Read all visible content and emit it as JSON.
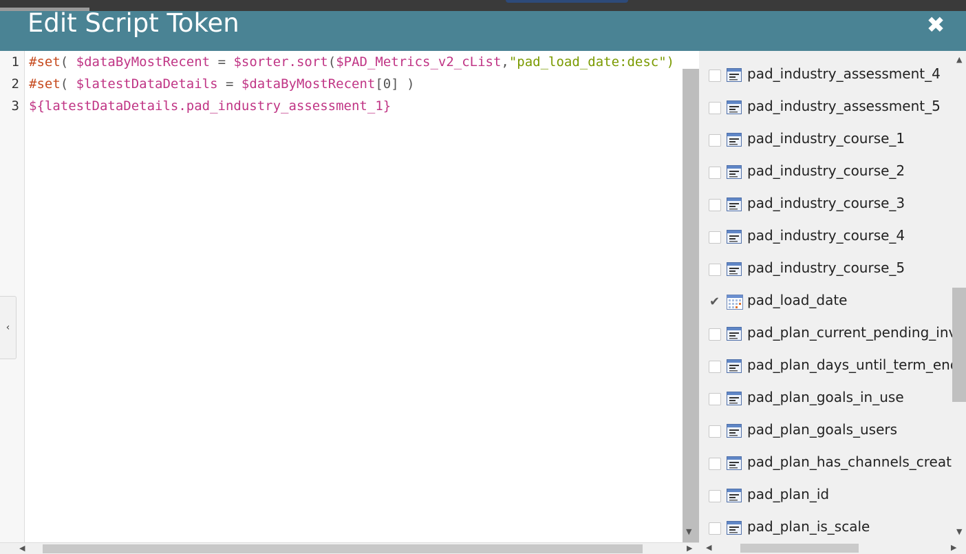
{
  "dialog": {
    "title": "Edit Script Token",
    "close_glyph": "✖"
  },
  "editor": {
    "line_numbers": [
      "1",
      "2",
      "3"
    ],
    "lines": [
      [
        {
          "cls": "kw",
          "text": "#set"
        },
        {
          "cls": "punct",
          "text": "( "
        },
        {
          "cls": "var",
          "text": "$dataByMostRecent"
        },
        {
          "cls": "punct",
          "text": " = "
        },
        {
          "cls": "var",
          "text": "$sorter.sort"
        },
        {
          "cls": "punct",
          "text": "("
        },
        {
          "cls": "var",
          "text": "$PAD_Metrics_v2_cList"
        },
        {
          "cls": "punct",
          "text": ","
        },
        {
          "cls": "str",
          "text": "\"pad_load_date:desc\")"
        }
      ],
      [
        {
          "cls": "kw",
          "text": "#set"
        },
        {
          "cls": "punct",
          "text": "( "
        },
        {
          "cls": "var",
          "text": "$latestDataDetails"
        },
        {
          "cls": "punct",
          "text": " = "
        },
        {
          "cls": "var",
          "text": "$dataByMostRecent"
        },
        {
          "cls": "punct",
          "text": "[0] )"
        }
      ],
      [
        {
          "cls": "var",
          "text": "${latestDataDetails.pad_industry_assessment_1}"
        }
      ]
    ]
  },
  "fields": [
    {
      "label": "pad_industry_assessment_4",
      "checked": false,
      "icon": "text-field-icon"
    },
    {
      "label": "pad_industry_assessment_5",
      "checked": false,
      "icon": "text-field-icon"
    },
    {
      "label": "pad_industry_course_1",
      "checked": false,
      "icon": "text-field-icon"
    },
    {
      "label": "pad_industry_course_2",
      "checked": false,
      "icon": "text-field-icon"
    },
    {
      "label": "pad_industry_course_3",
      "checked": false,
      "icon": "text-field-icon"
    },
    {
      "label": "pad_industry_course_4",
      "checked": false,
      "icon": "text-field-icon"
    },
    {
      "label": "pad_industry_course_5",
      "checked": false,
      "icon": "text-field-icon"
    },
    {
      "label": "pad_load_date",
      "checked": true,
      "icon": "calendar-field-icon"
    },
    {
      "label": "pad_plan_current_pending_invit",
      "checked": false,
      "icon": "text-field-icon"
    },
    {
      "label": "pad_plan_days_until_term_end_",
      "checked": false,
      "icon": "text-field-icon"
    },
    {
      "label": "pad_plan_goals_in_use",
      "checked": false,
      "icon": "text-field-icon"
    },
    {
      "label": "pad_plan_goals_users",
      "checked": false,
      "icon": "text-field-icon"
    },
    {
      "label": "pad_plan_has_channels_createc",
      "checked": false,
      "icon": "text-field-icon"
    },
    {
      "label": "pad_plan_id",
      "checked": false,
      "icon": "text-field-icon"
    },
    {
      "label": "pad_plan_is_scale",
      "checked": false,
      "icon": "text-field-icon"
    }
  ]
}
